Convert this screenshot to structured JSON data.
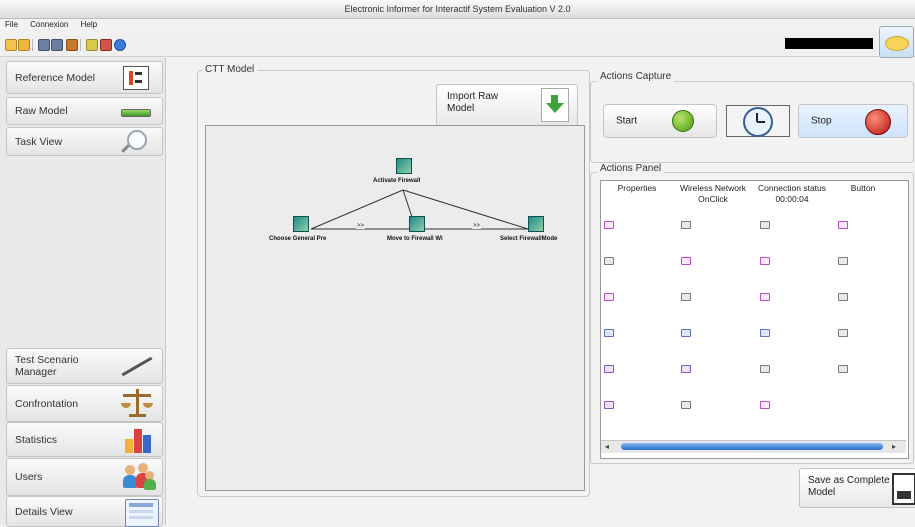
{
  "window": {
    "title": "Electronic Informer for Interactif System Evaluation V 2.0"
  },
  "menu": [
    "File",
    "Connexion",
    "Help"
  ],
  "sidebar": {
    "top": [
      {
        "label": "Reference Model",
        "icon": "tree-icon"
      },
      {
        "label": "Raw Model",
        "icon": "battery-icon"
      },
      {
        "label": "Task View",
        "icon": "magnifier-icon"
      }
    ],
    "bottom": [
      {
        "label": "Test Scenario\nManager",
        "icon": "pen-icon"
      },
      {
        "label": "Confrontation",
        "icon": "scales-icon"
      },
      {
        "label": "Statistics",
        "icon": "chart-icon"
      },
      {
        "label": "Users",
        "icon": "users-icon"
      },
      {
        "label": "Details View",
        "icon": "details-icon"
      }
    ]
  },
  "ctt": {
    "legend": "CTT Model",
    "import_label": "Import Raw\nModel",
    "nodes": {
      "root": "Activate Firewall",
      "n1": "Choose General Pre",
      "n2": "Move to Firewall Wi",
      "n3": "Select FirewallMode"
    },
    "operators": [
      ">>",
      ">>"
    ]
  },
  "capture": {
    "legend": "Actions Capture",
    "start": "Start",
    "stop": "Stop"
  },
  "panel": {
    "legend": "Actions Panel",
    "headers": [
      "Properties",
      "Wireless Network\nOnClick",
      "Connection status\n00:00:04",
      "Button"
    ]
  },
  "save_label": "Save as Complete\nModel",
  "colors": {
    "pink": "#c14bd0",
    "gray": "#7b7b7b",
    "blue": "#5a72c0",
    "purple": "#8a55c4",
    "scroll": "#2d6ec9"
  }
}
